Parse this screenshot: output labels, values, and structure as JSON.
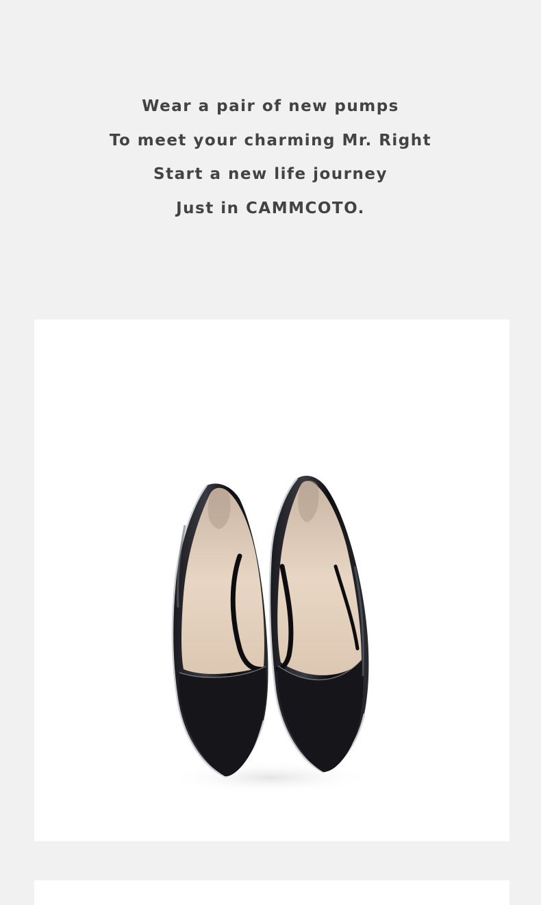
{
  "tagline": {
    "lines": [
      "Wear a pair of new pumps",
      "To meet your charming Mr. Right",
      "Start a new life journey",
      "Just in CAMMCOTO."
    ]
  },
  "product_image": {
    "subject": "pumps-icon"
  },
  "colors": {
    "page_background": "#f1f1f1",
    "card_background": "#ffffff",
    "text": "#434343"
  }
}
